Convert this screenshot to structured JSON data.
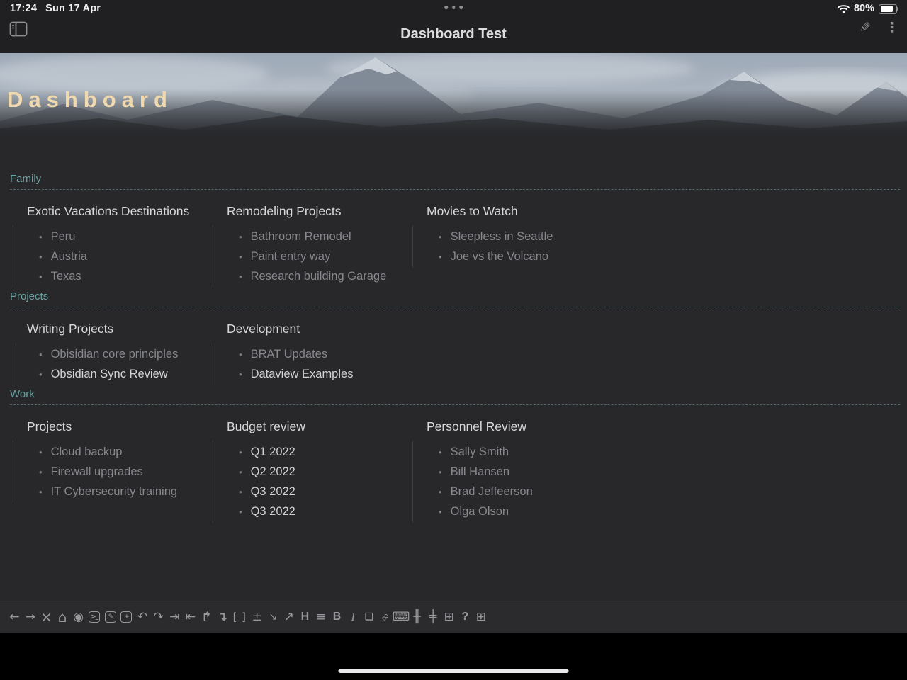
{
  "status_bar": {
    "time": "17:24",
    "date": "Sun 17 Apr",
    "battery": "80%"
  },
  "header": {
    "title": "Dashboard Test"
  },
  "banner": {
    "title": "Dashboard"
  },
  "sections": [
    {
      "label": "Family",
      "columns": [
        {
          "title": "Exotic Vacations Destinations",
          "items": [
            {
              "text": "Peru",
              "muted": true
            },
            {
              "text": "Austria",
              "muted": true
            },
            {
              "text": "Texas",
              "muted": true
            }
          ]
        },
        {
          "title": "Remodeling Projects",
          "items": [
            {
              "text": "Bathroom Remodel",
              "muted": true
            },
            {
              "text": "Paint entry way",
              "muted": true
            },
            {
              "text": "Research building Garage",
              "muted": true
            }
          ]
        },
        {
          "title": "Movies to Watch",
          "items": [
            {
              "text": "Sleepless in Seattle",
              "muted": true
            },
            {
              "text": "Joe vs the Volcano",
              "muted": true
            }
          ]
        }
      ]
    },
    {
      "label": "Projects",
      "columns": [
        {
          "title": "Writing Projects",
          "items": [
            {
              "text": "Obisidian core principles",
              "muted": true
            },
            {
              "text": "Obsidian Sync Review",
              "muted": false
            }
          ]
        },
        {
          "title": "Development",
          "items": [
            {
              "text": "BRAT Updates",
              "muted": true
            },
            {
              "text": "Dataview Examples",
              "muted": false
            }
          ]
        }
      ]
    },
    {
      "label": "Work",
      "columns": [
        {
          "title": "Projects",
          "items": [
            {
              "text": "Cloud backup",
              "muted": true
            },
            {
              "text": "Firewall upgrades",
              "muted": true
            },
            {
              "text": "IT Cybersecurity training",
              "muted": true
            }
          ]
        },
        {
          "title": "Budget review",
          "items": [
            {
              "text": "Q1 2022",
              "muted": false
            },
            {
              "text": "Q2 2022",
              "muted": false
            },
            {
              "text": "Q3 2022",
              "muted": false
            },
            {
              "text": "Q3 2022",
              "muted": false
            }
          ]
        },
        {
          "title": "Personnel Review",
          "items": [
            {
              "text": "Sally Smith",
              "muted": true
            },
            {
              "text": "Bill Hansen",
              "muted": true
            },
            {
              "text": "Brad Jeffeerson",
              "muted": true
            },
            {
              "text": "Olga Olson",
              "muted": true
            }
          ]
        }
      ]
    }
  ],
  "toolbar": {
    "icons": [
      {
        "name": "back-icon",
        "glyph": "←"
      },
      {
        "name": "forward-icon",
        "glyph": "→"
      },
      {
        "name": "close-icon",
        "glyph": "×",
        "cls": "big"
      },
      {
        "name": "home-icon",
        "glyph": "⌂",
        "cls": "big"
      },
      {
        "name": "navigate-icon",
        "glyph": "◉"
      },
      {
        "name": "terminal-icon",
        "glyph": ">_",
        "boxed": true
      },
      {
        "name": "compose-icon",
        "glyph": "✎",
        "boxed": true
      },
      {
        "name": "add-note-icon",
        "glyph": "+",
        "boxed": true
      },
      {
        "name": "undo-icon",
        "glyph": "↶"
      },
      {
        "name": "redo-icon",
        "glyph": "↷"
      },
      {
        "name": "indent-icon",
        "glyph": "⇥"
      },
      {
        "name": "outdent-icon",
        "glyph": "⇤"
      },
      {
        "name": "jump-up-icon",
        "glyph": "↱",
        "cls": "bold"
      },
      {
        "name": "jump-down-icon",
        "glyph": "↴",
        "cls": "bold"
      },
      {
        "name": "internal-link-brackets-icon",
        "glyph": "[ ]",
        "cls": "wide"
      },
      {
        "name": "plus-minus-icon",
        "glyph": "±"
      },
      {
        "name": "collapse-icon",
        "glyph": "↘",
        "cls": "small"
      },
      {
        "name": "expand-icon",
        "glyph": "↗"
      },
      {
        "name": "heading-icon",
        "glyph": "H",
        "cls": "serifB"
      },
      {
        "name": "bullet-list-icon",
        "glyph": "≡"
      },
      {
        "name": "bold-icon",
        "glyph": "B",
        "cls": "serifB"
      },
      {
        "name": "italic-icon",
        "glyph": "I",
        "cls": "serifI"
      },
      {
        "name": "note-page-icon",
        "glyph": "❏",
        "cls": "small"
      },
      {
        "name": "link-icon",
        "glyph": "∞",
        "cls": "rot"
      },
      {
        "name": "keyboard-icon",
        "glyph": "⌨"
      },
      {
        "name": "split-vertical-icon",
        "glyph": "╫"
      },
      {
        "name": "split-horizontal-icon",
        "glyph": "╪"
      },
      {
        "name": "new-tab-icon",
        "glyph": "⊞"
      },
      {
        "name": "help-icon",
        "glyph": "?",
        "cls": "serifB"
      },
      {
        "name": "popout-window-icon",
        "glyph": "⊞"
      }
    ]
  },
  "colors": {
    "accent-teal": "#68a2a3",
    "banner-text": "#f0d9af",
    "item-bright": "#d2d2d4",
    "item-muted": "#87888c",
    "content-bg": "#28282a",
    "bar-bg": "#202022"
  }
}
